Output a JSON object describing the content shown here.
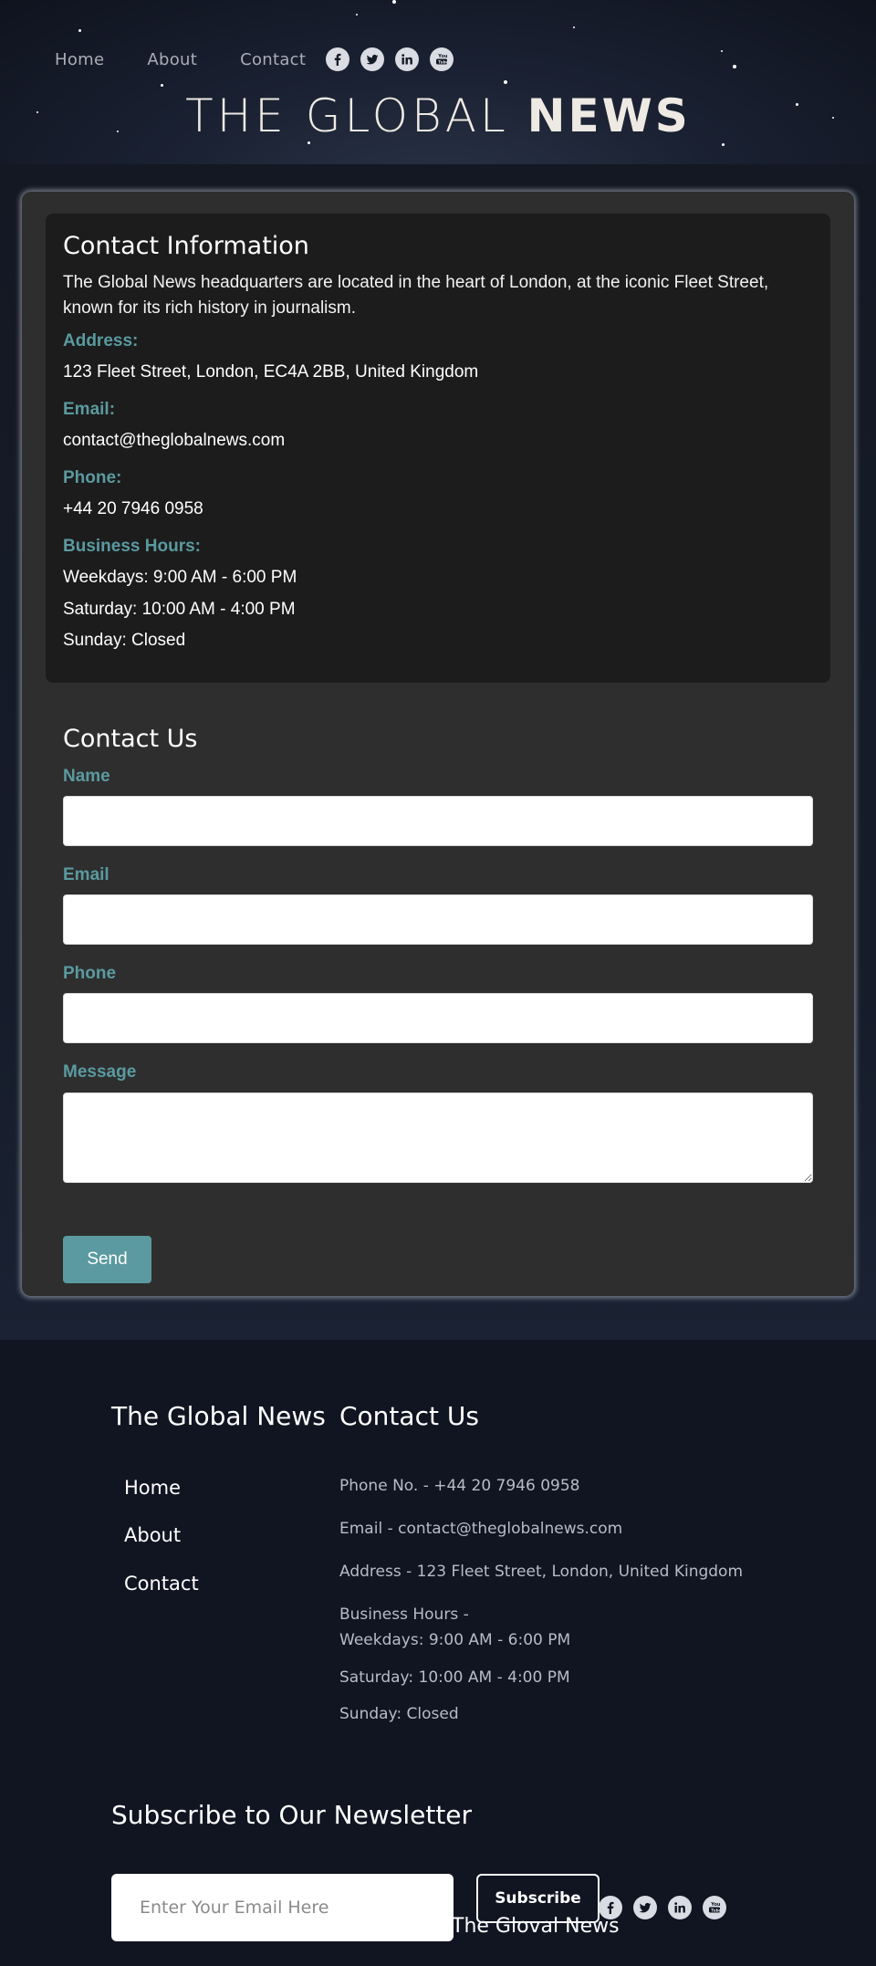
{
  "header": {
    "nav": [
      "Home",
      "About",
      "Contact"
    ],
    "social_icons": [
      "facebook-icon",
      "twitter-icon",
      "linkedin-icon",
      "youtube-icon"
    ],
    "title_light": "THE GLOBAL ",
    "title_bold": "NEWS"
  },
  "contact_info": {
    "heading": "Contact Information",
    "intro": "The Global News headquarters are located in the heart of London, at the iconic Fleet Street, known for its rich history in journalism.",
    "address_label": "Address:",
    "address": "123 Fleet Street, London, EC4A 2BB, United Kingdom",
    "email_label": "Email:",
    "email": "contact@theglobalnews.com",
    "phone_label": "Phone:",
    "phone": "+44 20 7946 0958",
    "hours_label": "Business Hours:",
    "hours": [
      "Weekdays: 9:00 AM - 6:00 PM",
      "Saturday: 10:00 AM - 4:00 PM",
      "Sunday: Closed"
    ]
  },
  "contact_form": {
    "heading": "Contact Us",
    "name_label": "Name",
    "name_value": "",
    "email_label": "Email",
    "email_value": "",
    "phone_label": "Phone",
    "phone_value": "",
    "message_label": "Message",
    "message_value": "",
    "send_label": "Send"
  },
  "footer": {
    "brand_heading": "The Global News",
    "contact_heading": "Contact Us",
    "nav": [
      "Home",
      "About",
      "Contact"
    ],
    "phone": "Phone No. - +44 20 7946 0958",
    "email": "Email - contact@theglobalnews.com",
    "address": "Address - 123 Fleet Street, London, United Kingdom",
    "hours_label": "Business Hours -",
    "hours": [
      "Weekdays: 9:00 AM - 6:00 PM",
      "Saturday: 10:00 AM - 4:00 PM",
      "Sunday: Closed"
    ],
    "newsletter_heading": "Subscribe to Our Newsletter",
    "newsletter_placeholder": "Enter Your Email Here",
    "subscribe_label": "Subscribe",
    "brand_bottom": "The Gloval News"
  },
  "colors": {
    "accent": "#5a9aa0",
    "page_bg": "#111421",
    "card_bg": "#2e2e2e",
    "info_bg": "#1c1c1c"
  }
}
